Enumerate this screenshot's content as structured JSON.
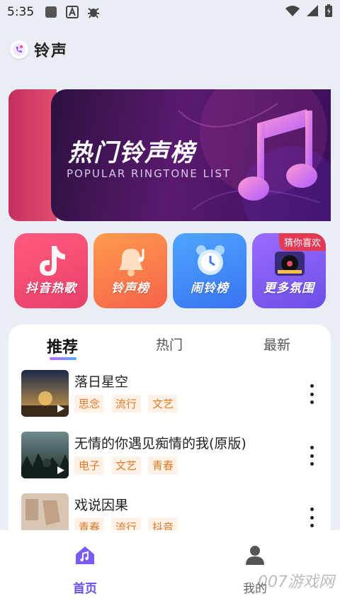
{
  "status_bar": {
    "time": "5:35"
  },
  "app": {
    "title": "铃声"
  },
  "banner": {
    "title": "热门铃声榜",
    "subtitle": "POPULAR RINGTONE LIST"
  },
  "shortcuts": [
    {
      "label": "抖音热歌",
      "color": "#ff5a7e"
    },
    {
      "label": "铃声榜",
      "color": "#ff8a4d"
    },
    {
      "label": "闹铃榜",
      "color": "#4a8dff"
    },
    {
      "label": "更多氛围",
      "color": "#8a5dff",
      "badge": "猜你喜欢"
    }
  ],
  "tabs": [
    {
      "label": "推荐",
      "active": true
    },
    {
      "label": "热门",
      "active": false
    },
    {
      "label": "最新",
      "active": false
    }
  ],
  "songs": [
    {
      "title": "落日星空",
      "tags": [
        "思念",
        "流行",
        "文艺"
      ]
    },
    {
      "title": "无情的你遇见痴情的我(原版)",
      "tags": [
        "电子",
        "文艺",
        "青春"
      ]
    },
    {
      "title": "戏说因果",
      "tags": [
        "青春",
        "流行",
        "抖音"
      ]
    }
  ],
  "tab_bar": {
    "home_label": "首页",
    "mine_label": "我的"
  },
  "watermark": "007游戏网"
}
